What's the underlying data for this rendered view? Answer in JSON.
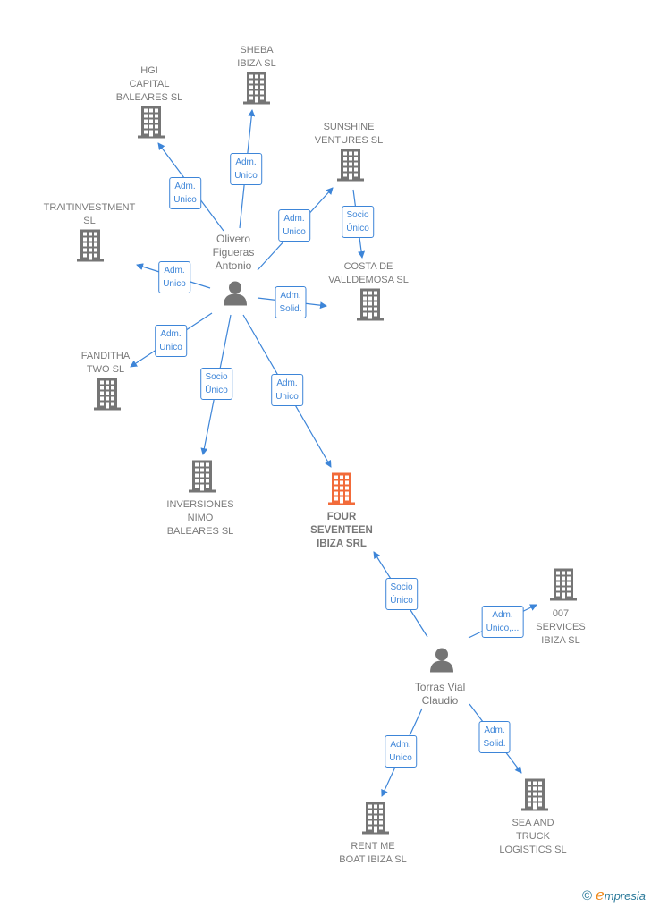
{
  "colors": {
    "edge": "#3d85d8",
    "company": "#757575",
    "main_company": "#f26b3a",
    "person": "#757575",
    "label": "#7a7a7a"
  },
  "nodes": [
    {
      "id": "sheba",
      "type": "company",
      "lines": [
        "SHEBA",
        "IBIZA  SL"
      ]
    },
    {
      "id": "hgi",
      "type": "company",
      "lines": [
        "HGI",
        "CAPITAL",
        "BALEARES  SL"
      ]
    },
    {
      "id": "sunshine",
      "type": "company",
      "lines": [
        "SUNSHINE",
        "VENTURES  SL"
      ]
    },
    {
      "id": "trait",
      "type": "company",
      "lines": [
        "TRAITINVESTMENT",
        "SL"
      ]
    },
    {
      "id": "costa",
      "type": "company",
      "lines": [
        "COSTA DE",
        "VALLDEMOSA SL"
      ]
    },
    {
      "id": "fanditha",
      "type": "company",
      "lines": [
        "FANDITHA",
        "TWO SL"
      ]
    },
    {
      "id": "inversiones",
      "type": "company",
      "lines": [
        "INVERSIONES",
        "NIMO",
        "BALEARES  SL"
      ]
    },
    {
      "id": "four",
      "type": "main_company",
      "lines": [
        "FOUR",
        "SEVENTEEN",
        "IBIZA SRL"
      ]
    },
    {
      "id": "s007",
      "type": "company",
      "lines": [
        "007",
        "SERVICES",
        "IBIZA  SL"
      ]
    },
    {
      "id": "sea",
      "type": "company",
      "lines": [
        "SEA AND",
        "TRUCK",
        "LOGISTICS SL"
      ]
    },
    {
      "id": "rent",
      "type": "company",
      "lines": [
        "RENT ME",
        "BOAT IBIZA  SL"
      ]
    },
    {
      "id": "olivero",
      "type": "person",
      "lines": [
        "Olivero",
        "Figueras",
        "Antonio"
      ]
    },
    {
      "id": "torras",
      "type": "person",
      "lines": [
        "Torras Vial",
        "Claudio"
      ]
    }
  ],
  "edges": [
    {
      "from": "olivero",
      "to": "sheba",
      "label": [
        "Adm.",
        "Unico"
      ]
    },
    {
      "from": "olivero",
      "to": "hgi",
      "label": [
        "Adm.",
        "Unico"
      ]
    },
    {
      "from": "olivero",
      "to": "sunshine",
      "label": [
        "Adm.",
        "Unico"
      ]
    },
    {
      "from": "olivero",
      "to": "trait",
      "label": [
        "Adm.",
        "Unico"
      ]
    },
    {
      "from": "olivero",
      "to": "costa",
      "label": [
        "Adm.",
        "Solid."
      ]
    },
    {
      "from": "olivero",
      "to": "fanditha",
      "label": [
        "Adm.",
        "Unico"
      ]
    },
    {
      "from": "olivero",
      "to": "inversiones",
      "label": [
        "Socio",
        "Único"
      ]
    },
    {
      "from": "olivero",
      "to": "four",
      "label": [
        "Adm.",
        "Unico"
      ]
    },
    {
      "from": "sunshine",
      "to": "costa",
      "label": [
        "Socio",
        "Único"
      ]
    },
    {
      "from": "torras",
      "to": "four",
      "label": [
        "Socio",
        "Único"
      ]
    },
    {
      "from": "torras",
      "to": "s007",
      "label": [
        "Adm.",
        "Unico,..."
      ]
    },
    {
      "from": "torras",
      "to": "rent",
      "label": [
        "Adm.",
        "Unico"
      ]
    },
    {
      "from": "torras",
      "to": "sea",
      "label": [
        "Adm.",
        "Solid."
      ]
    }
  ],
  "footer": {
    "copyright": "©",
    "brand_first": "e",
    "brand_rest": "mpresia"
  }
}
